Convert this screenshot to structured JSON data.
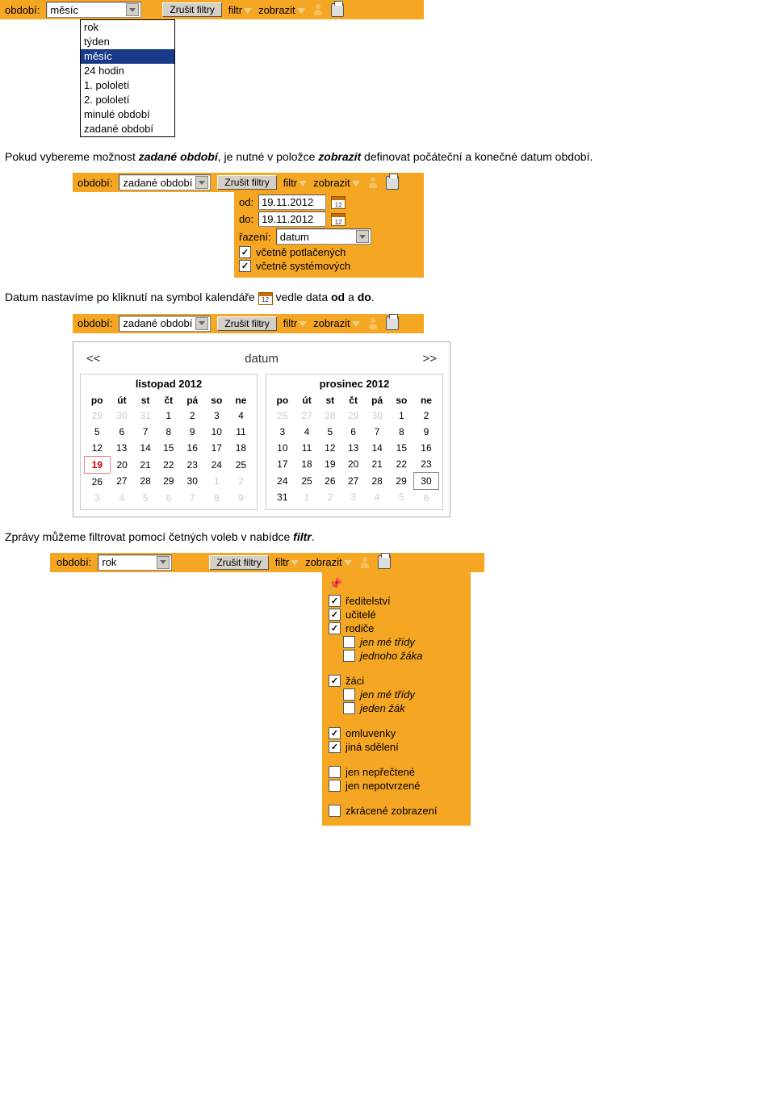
{
  "bar1": {
    "label": "období:",
    "value": "měsíc",
    "cancel": "Zrušit filtry",
    "filtr": "filtr",
    "zobrazit": "zobrazit"
  },
  "dd": {
    "items": [
      "rok",
      "týden",
      "měsíc",
      "24 hodin",
      "1. pololetí",
      "2. pololetí",
      "minulé období",
      "zadané období"
    ],
    "selected": 2
  },
  "p1": {
    "a": "Pokud vybereme možnost ",
    "b": "zadané období",
    "c": ", je nutné v položce ",
    "d": "zobrazit",
    "e": " definovat počáteční a konečné datum období."
  },
  "bar2": {
    "label": "období:",
    "value": "zadané období",
    "cancel": "Zrušit filtry",
    "filtr": "filtr",
    "zobrazit": "zobrazit"
  },
  "sub": {
    "od_l": "od:",
    "od_v": "19.11.2012",
    "do_l": "do:",
    "do_v": "19.11.2012",
    "raz_l": "řazení:",
    "raz_v": "datum",
    "c1": "včetně potlačených",
    "c2": "včetně systémových"
  },
  "p2": {
    "a": "Datum nastavíme po kliknutí na symbol kalendáře ",
    "b": " vedle data ",
    "c": "od",
    "d": " a ",
    "e": "do",
    "f": "."
  },
  "bar3": {
    "label": "období:",
    "value": "zadané období",
    "cancel": "Zrušit filtry",
    "filtr": "filtr",
    "zobrazit": "zobrazit"
  },
  "calhd": {
    "prev": "<<",
    "title": "datum",
    "next": ">>"
  },
  "m1": {
    "title": "listopad 2012",
    "dh": [
      "po",
      "út",
      "st",
      "čt",
      "pá",
      "so",
      "ne"
    ],
    "w": [
      [
        {
          "d": "29",
          "o": 1
        },
        {
          "d": "30",
          "o": 1
        },
        {
          "d": "31",
          "o": 1
        },
        {
          "d": "1"
        },
        {
          "d": "2"
        },
        {
          "d": "3"
        },
        {
          "d": "4"
        }
      ],
      [
        {
          "d": "5"
        },
        {
          "d": "6"
        },
        {
          "d": "7"
        },
        {
          "d": "8"
        },
        {
          "d": "9"
        },
        {
          "d": "10"
        },
        {
          "d": "11"
        }
      ],
      [
        {
          "d": "12"
        },
        {
          "d": "13"
        },
        {
          "d": "14"
        },
        {
          "d": "15"
        },
        {
          "d": "16"
        },
        {
          "d": "17"
        },
        {
          "d": "18"
        }
      ],
      [
        {
          "d": "19",
          "t": 1
        },
        {
          "d": "20"
        },
        {
          "d": "21"
        },
        {
          "d": "22"
        },
        {
          "d": "23"
        },
        {
          "d": "24"
        },
        {
          "d": "25"
        }
      ],
      [
        {
          "d": "26"
        },
        {
          "d": "27"
        },
        {
          "d": "28"
        },
        {
          "d": "29"
        },
        {
          "d": "30"
        },
        {
          "d": "1",
          "o": 1
        },
        {
          "d": "2",
          "o": 1
        }
      ],
      [
        {
          "d": "3",
          "o": 1
        },
        {
          "d": "4",
          "o": 1
        },
        {
          "d": "5",
          "o": 1
        },
        {
          "d": "6",
          "o": 1
        },
        {
          "d": "7",
          "o": 1
        },
        {
          "d": "8",
          "o": 1
        },
        {
          "d": "9",
          "o": 1
        }
      ]
    ]
  },
  "m2": {
    "title": "prosinec 2012",
    "dh": [
      "po",
      "út",
      "st",
      "čt",
      "pá",
      "so",
      "ne"
    ],
    "w": [
      [
        {
          "d": "26",
          "o": 1
        },
        {
          "d": "27",
          "o": 1
        },
        {
          "d": "28",
          "o": 1
        },
        {
          "d": "29",
          "o": 1
        },
        {
          "d": "30",
          "o": 1
        },
        {
          "d": "1"
        },
        {
          "d": "2"
        }
      ],
      [
        {
          "d": "3"
        },
        {
          "d": "4"
        },
        {
          "d": "5"
        },
        {
          "d": "6"
        },
        {
          "d": "7"
        },
        {
          "d": "8"
        },
        {
          "d": "9"
        }
      ],
      [
        {
          "d": "10"
        },
        {
          "d": "11"
        },
        {
          "d": "12"
        },
        {
          "d": "13"
        },
        {
          "d": "14"
        },
        {
          "d": "15"
        },
        {
          "d": "16"
        }
      ],
      [
        {
          "d": "17"
        },
        {
          "d": "18"
        },
        {
          "d": "19"
        },
        {
          "d": "20"
        },
        {
          "d": "21"
        },
        {
          "d": "22"
        },
        {
          "d": "23"
        }
      ],
      [
        {
          "d": "24"
        },
        {
          "d": "25"
        },
        {
          "d": "26"
        },
        {
          "d": "27"
        },
        {
          "d": "28"
        },
        {
          "d": "29"
        },
        {
          "d": "30",
          "b": 1
        }
      ],
      [
        {
          "d": "31"
        },
        {
          "d": "1",
          "o": 1
        },
        {
          "d": "2",
          "o": 1
        },
        {
          "d": "3",
          "o": 1
        },
        {
          "d": "4",
          "o": 1
        },
        {
          "d": "5",
          "o": 1
        },
        {
          "d": "6",
          "o": 1
        }
      ]
    ]
  },
  "p3": {
    "a": "Zprávy můžeme filtrovat pomocí četných voleb v nabídce ",
    "b": "filtr",
    "c": "."
  },
  "bar4": {
    "label": "období:",
    "value": "rok",
    "cancel": "Zrušit filtry",
    "filtr": "filtr",
    "zobrazit": "zobrazit"
  },
  "fm": {
    "g1": [
      {
        "l": "ředitelství",
        "c": 1
      },
      {
        "l": "učitelé",
        "c": 1
      },
      {
        "l": "rodiče",
        "c": 1
      },
      {
        "l": "jen mé třídy",
        "c": 0,
        "i": 1,
        "it": 1
      },
      {
        "l": "jednoho žáka",
        "c": 0,
        "i": 1,
        "it": 1
      }
    ],
    "g2": [
      {
        "l": "žáci",
        "c": 1
      },
      {
        "l": "jen mé třídy",
        "c": 0,
        "i": 1,
        "it": 1
      },
      {
        "l": "jeden žák",
        "c": 0,
        "i": 1,
        "it": 1
      }
    ],
    "g3": [
      {
        "l": "omluvenky",
        "c": 1
      },
      {
        "l": "jiná sdělení",
        "c": 1
      }
    ],
    "g4": [
      {
        "l": "jen nepřečtené",
        "c": 0
      },
      {
        "l": "jen nepotvrzené",
        "c": 0
      }
    ],
    "g5": [
      {
        "l": "zkrácené zobrazení",
        "c": 0
      }
    ]
  }
}
